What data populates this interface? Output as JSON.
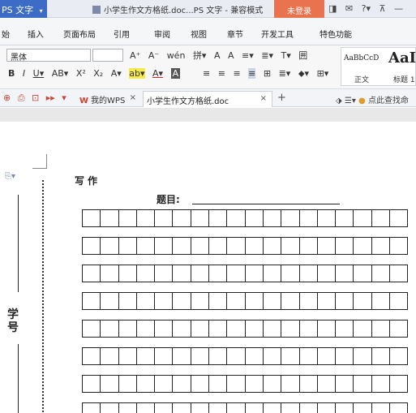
{
  "titlebar": {
    "app_label": "PS 文字",
    "app_arrow": "▾",
    "doc_title": "小学生作文方格纸.doc...PS 文字 - 兼容模式",
    "login_label": "未登录",
    "tools": [
      "◨",
      "✉",
      "?▾",
      "⊼",
      "—"
    ]
  },
  "ribbon_tabs": [
    "始",
    "插入",
    "页面布局",
    "引用",
    "审阅",
    "视图",
    "章节",
    "开发工具",
    "特色功能"
  ],
  "ribbon": {
    "font_name": "黑体",
    "font_size": "",
    "row1_tools": [
      "A⁺",
      "A⁻",
      "wén",
      "拼▾",
      "A",
      "A",
      "≡▾",
      "≣▾",
      "T▾",
      "囲"
    ],
    "row2_tools": [
      "B",
      "I",
      "U▾",
      "AB▾",
      "X²",
      "X₂",
      "A▾",
      "ab▾",
      "A▾",
      "A"
    ],
    "row2_para_tools": [
      "≡",
      "≡",
      "≡",
      "≡",
      "⊞",
      "≣▾",
      "⬥▾",
      "⊞▾"
    ]
  },
  "styles": {
    "sample1": "AaBbCcD",
    "sample2": "AaI",
    "name1": "正文",
    "name2": "标题 1"
  },
  "docstrip": {
    "icons": [
      "⊕",
      "⎙",
      "⊡",
      "▸▸",
      "▾"
    ],
    "wps_icon": "W",
    "wps_tab": "我的WPS",
    "active_tab": "小学生作文方格纸.doc",
    "close": "×",
    "new_tab": "+",
    "right_icons": "⬗  ☰▾",
    "search_bulb": "●",
    "search_hint": "点此查找命"
  },
  "document": {
    "side_icon": "⎘▾",
    "side_label": "学号",
    "writing_label": "写作",
    "topic_label": "题目:"
  },
  "grid": {
    "rows": 8,
    "cols": 18
  }
}
